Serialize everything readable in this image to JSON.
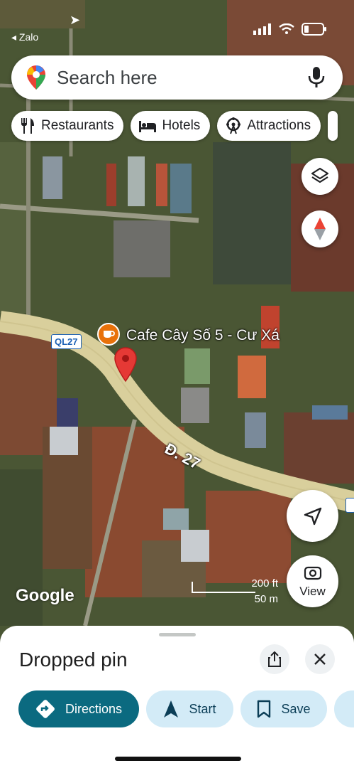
{
  "status_bar": {
    "back_app": "◂ Zalo"
  },
  "search": {
    "placeholder": "Search here"
  },
  "chips": [
    {
      "label": "Restaurants",
      "icon": "fork-knife-icon"
    },
    {
      "label": "Hotels",
      "icon": "bed-icon"
    },
    {
      "label": "Attractions",
      "icon": "ferris-wheel-icon"
    }
  ],
  "map": {
    "place_label": "Cafe Cây Số 5 - Cư Xá",
    "road_shield": "QL27",
    "road_name": "Đ. 27",
    "scale_ft": "200 ft",
    "scale_m": "50 m",
    "brand": "Google",
    "view_button": "View",
    "colors": {
      "road": "#d9cf9c",
      "pin": "#e53935",
      "cafe_icon": "#e8710a"
    }
  },
  "sheet": {
    "title": "Dropped pin",
    "actions": [
      {
        "label": "Directions",
        "icon": "directions-icon"
      },
      {
        "label": "Start",
        "icon": "navigation-arrow-icon"
      },
      {
        "label": "Save",
        "icon": "bookmark-icon"
      }
    ],
    "colors": {
      "primary": "#0b6a80",
      "secondary": "#d3ebf7"
    }
  }
}
